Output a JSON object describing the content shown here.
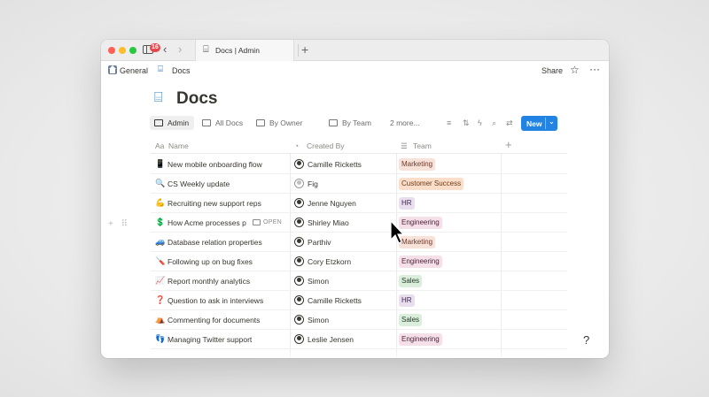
{
  "browser": {
    "notification_count": "16",
    "tab_title": "Docs | Admin",
    "new_tab": "+",
    "back_arrow": "‹",
    "forward_arrow": "›",
    "tab_icon": "⌸"
  },
  "breadcrumb": {
    "items": [
      {
        "label": "General",
        "icon": "home-icon"
      },
      {
        "label": "Docs",
        "icon": "docs-icon"
      }
    ],
    "share_label": "Share",
    "star_glyph": "☆",
    "more_glyph": "···"
  },
  "page": {
    "icon_glyph": "⌸",
    "title": "Docs"
  },
  "views": {
    "tabs": [
      {
        "label": "Admin",
        "active": true
      },
      {
        "label": "All Docs",
        "active": false
      },
      {
        "label": "By Owner",
        "active": false
      },
      {
        "label": "By Team",
        "active": false
      }
    ],
    "more_label": "2 more...",
    "toolbar_icons": {
      "filter": "≡",
      "sort": "⇅",
      "automation": "ϟ",
      "search": "⌕",
      "settings": "⇄"
    },
    "new_button_label": "New",
    "new_button_caret": "⌄"
  },
  "table": {
    "headers": {
      "name": "Name",
      "name_icon": "Aa",
      "created_by": "Created By",
      "created_by_icon": "◔",
      "team": "Team",
      "team_icon": "☰",
      "add": "+"
    },
    "rows": [
      {
        "emoji": "📱",
        "name": "New mobile onboarding flow",
        "person": "Camille Ricketts",
        "avatar": "dark",
        "team": "Marketing",
        "team_color": "#f7e2da",
        "team_text": "#6b3a2a"
      },
      {
        "emoji": "🔍",
        "name": "CS Weekly update",
        "person": "Fig",
        "avatar": "light",
        "team": "Customer Success",
        "team_color": "#fadec9",
        "team_text": "#6b3a1c"
      },
      {
        "emoji": "💪",
        "name": "Recruiting new support reps",
        "person": "Jenne Nguyen",
        "avatar": "dark",
        "team": "HR",
        "team_color": "#e8deee",
        "team_text": "#412454"
      },
      {
        "emoji": "💲",
        "name": "How Acme processes p",
        "person": "Shirley Miao",
        "avatar": "dark",
        "team": "Engineering",
        "team_color": "#f5e0e9",
        "team_text": "#4c2337"
      },
      {
        "emoji": "🚙",
        "name": "Database relation properties",
        "person": "Parthiv",
        "avatar": "dark",
        "team": "Marketing",
        "team_color": "#f7e2da",
        "team_text": "#6b3a2a"
      },
      {
        "emoji": "🪛",
        "name": "Following up on bug fixes",
        "person": "Cory Etzkorn",
        "avatar": "dark",
        "team": "Engineering",
        "team_color": "#f5e0e9",
        "team_text": "#4c2337"
      },
      {
        "emoji": "📈",
        "name": "Report monthly analytics",
        "person": "Simon",
        "avatar": "dark",
        "team": "Sales",
        "team_color": "#dbeddb",
        "team_text": "#1c3829"
      },
      {
        "emoji": "❓",
        "name": "Question to ask in interviews",
        "person": "Camille Ricketts",
        "avatar": "dark",
        "team": "HR",
        "team_color": "#e8deee",
        "team_text": "#412454"
      },
      {
        "emoji": "⛺",
        "name": "Commenting for documents",
        "person": "Simon",
        "avatar": "dark",
        "team": "Sales",
        "team_color": "#dbeddb",
        "team_text": "#1c3829"
      },
      {
        "emoji": "👣",
        "name": "Managing Twitter support",
        "person": "Leslie Jensen",
        "avatar": "dark",
        "team": "Engineering",
        "team_color": "#f5e0e9",
        "team_text": "#4c2337"
      }
    ],
    "open_label": "OPEN",
    "row_handle": "+ ⠿",
    "help_glyph": "?"
  }
}
